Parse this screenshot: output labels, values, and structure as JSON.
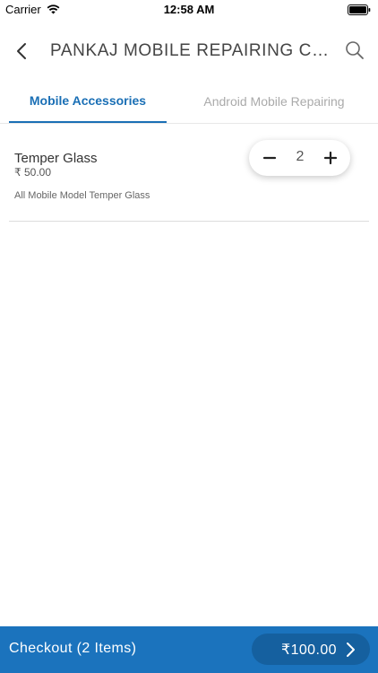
{
  "status_bar": {
    "carrier": "Carrier",
    "time": "12:58 AM"
  },
  "header": {
    "title": "PANKAJ MOBILE REPAIRING CEN...",
    "back_icon": "back-arrow-icon",
    "search_icon": "search-icon"
  },
  "tabs": [
    {
      "label": "Mobile Accessories",
      "active": true
    },
    {
      "label": "Android Mobile Repairing",
      "active": false
    }
  ],
  "products": [
    {
      "name": "Temper Glass",
      "price": "₹ 50.00",
      "description": "All Mobile Model Temper Glass",
      "quantity": "2"
    }
  ],
  "checkout": {
    "label": "Checkout (2 Items)",
    "total": "₹100.00"
  },
  "colors": {
    "accent": "#1b73bd",
    "accent_dark": "#15609f",
    "active_tab": "#1a6fb5",
    "inactive_tab": "#aaaaaa"
  }
}
